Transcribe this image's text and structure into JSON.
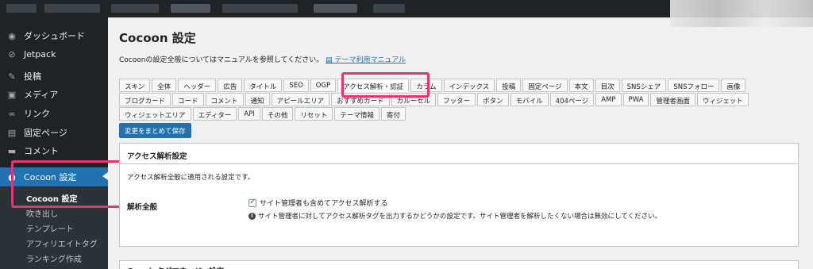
{
  "sidebar": {
    "items": [
      {
        "icon": "dashboard-icon",
        "glyph": "◉",
        "label": "ダッシュボード"
      },
      {
        "icon": "jetpack-icon",
        "glyph": "⊘",
        "label": "Jetpack"
      },
      {
        "icon": "pin-icon",
        "glyph": "✎",
        "label": "投稿"
      },
      {
        "icon": "media-icon",
        "glyph": "▣",
        "label": "メディア"
      },
      {
        "icon": "link-icon",
        "glyph": "∞",
        "label": "リンク"
      },
      {
        "icon": "page-icon",
        "glyph": "▤",
        "label": "固定ページ"
      },
      {
        "icon": "comment-icon",
        "glyph": "▬",
        "label": "コメント"
      },
      {
        "icon": "cocoon-icon",
        "glyph": "●",
        "label": "Cocoon 設定"
      }
    ],
    "submenu": [
      "Cocoon 設定",
      "吹き出し",
      "テンプレート",
      "アフィリエイトタグ",
      "ランキング作成"
    ]
  },
  "main": {
    "title": "Cocoon 設定",
    "notice_text": "Cocoonの設定全般についてはマニュアルを参照してください。",
    "notice_link": "テーマ利用マニュアル",
    "tabs_row1": [
      "スキン",
      "全体",
      "ヘッダー",
      "広告",
      "タイトル",
      "SEO",
      "OGP",
      "アクセス解析・認証",
      "カラム",
      "インデックス",
      "投稿",
      "固定ページ",
      "本文",
      "目次",
      "SNSシェア",
      "SNSフォロー",
      "画像"
    ],
    "tabs_row2": [
      "ブログカード",
      "コード",
      "コメント",
      "通知",
      "アピールエリア",
      "おすすめカード",
      "カルーセル",
      "フッター",
      "ボタン",
      "モバイル",
      "404ページ",
      "AMP",
      "PWA",
      "管理者画面",
      "ウィジェット"
    ],
    "tabs_row3": [
      "ウィジェットエリア",
      "エディター",
      "API",
      "その他",
      "リセット",
      "テーマ情報",
      "寄付"
    ],
    "save_label": "変更をまとめて保存",
    "panel_title": "アクセス解析設定",
    "panel_desc": "アクセス解析全般に適用される設定です。",
    "setting_label": "解析全般",
    "checkbox_label": "サイト管理者も含めてアクセス解析する",
    "help_text": "サイト管理者に対してアクセス解析タグを出力するかどうかの設定です。サイト管理者を解析したくない場合は無効にしてください。",
    "next_panel_title": "Googleタグマネージャ設定"
  }
}
